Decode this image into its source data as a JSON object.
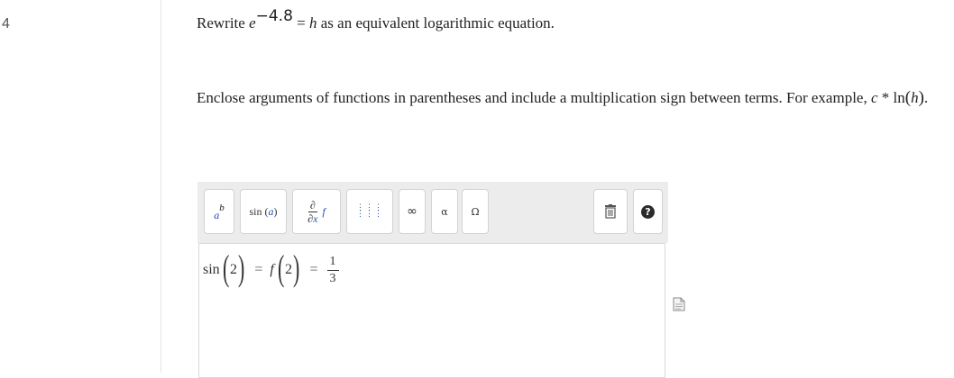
{
  "question": {
    "number": "4",
    "prefix": "Rewrite ",
    "base": "e",
    "exponent": "−4.8",
    "equals": "=",
    "var": "h",
    "suffix": " as an equivalent logarithmic equation."
  },
  "instructions": {
    "text1": "Enclose arguments of functions in parentheses and include a multiplication sign between terms. For example, ",
    "example_c": "c",
    "example_times": " * ",
    "example_ln": "ln",
    "example_open": "(",
    "example_arg": "h",
    "example_close": ")",
    "example_end": "."
  },
  "toolbar": {
    "power_base": "a",
    "power_exp": "b",
    "sin_label": "sin",
    "sin_arg": "a",
    "deriv_num": "∂",
    "deriv_den_d": "∂",
    "deriv_den_x": "x",
    "deriv_f": "f",
    "matrix_glyph": "⋮⋮⋮\n⋮⋮⋮",
    "infinity": "∞",
    "alpha": "α",
    "omega": "Ω",
    "help": "?",
    "icons": [
      "power-icon",
      "sin-icon",
      "derivative-icon",
      "matrix-icon",
      "infinity-icon",
      "alpha-icon",
      "omega-icon",
      "trash-icon",
      "help-icon"
    ]
  },
  "editor": {
    "fn1": "sin",
    "arg1": "2",
    "eq1": "=",
    "fn2": "f",
    "arg2": "2",
    "eq2": "=",
    "frac_num": "1",
    "frac_den": "3"
  }
}
